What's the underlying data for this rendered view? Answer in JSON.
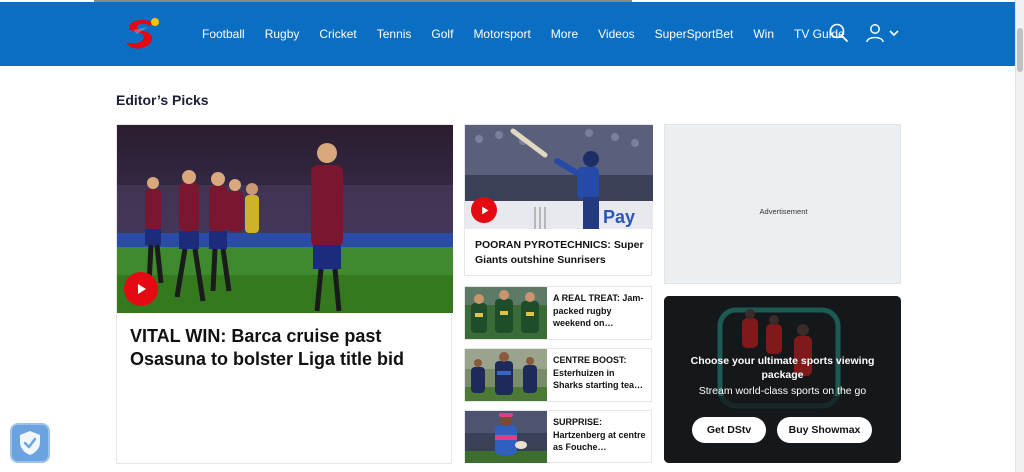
{
  "nav": {
    "items": [
      "Football",
      "Rugby",
      "Cricket",
      "Tennis",
      "Golf",
      "Motorsport",
      "More",
      "Videos",
      "SuperSportBet",
      "Win",
      "TV Guide"
    ],
    "icons": [
      "search-icon",
      "user-icon",
      "chevron-down-icon"
    ]
  },
  "brand": {
    "primary": "#0a6ec2",
    "accent": "#e50914"
  },
  "section_title": "Editor’s Picks",
  "hero": {
    "headline": "VITAL WIN: Barca cruise past Osasuna to bolster Liga title bid"
  },
  "cricket": {
    "headline": "POORAN PYROTECHNICS: Super Giants outshine Sunrisers",
    "board_text": "Pay"
  },
  "stories": [
    {
      "headline": "A REAL TREAT: Jam-packed rugby weekend on…"
    },
    {
      "headline": "CENTRE BOOST: Esterhuizen in Sharks starting tea…"
    },
    {
      "headline": "SURPRISE: Hartzenberg at centre as Fouche…"
    }
  ],
  "ad": {
    "label": "Advertisement"
  },
  "promo": {
    "title": "Choose your ultimate sports viewing package",
    "subtitle": "Stream world-class sports on the go",
    "btn_dstv": "Get DStv",
    "btn_showmax": "Buy Showmax"
  }
}
